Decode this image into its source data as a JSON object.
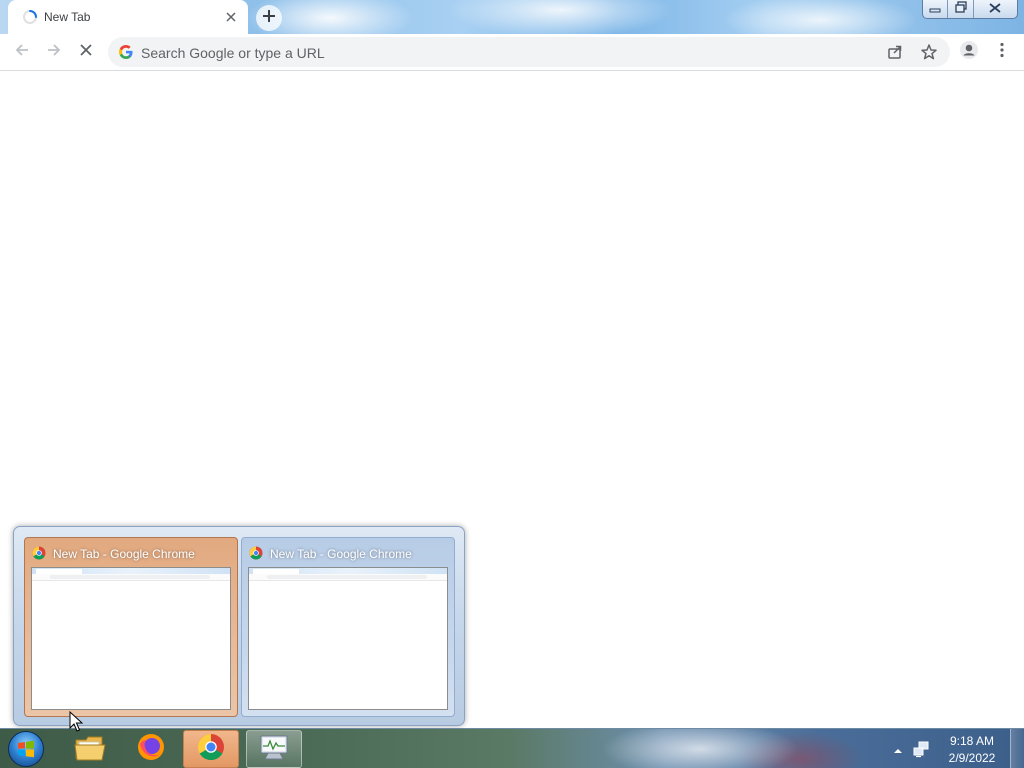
{
  "browser": {
    "tab": {
      "title": "New Tab",
      "loading_icon": "loading-spinner-icon",
      "close_icon": "close-icon"
    },
    "new_tab_icon": "plus-icon",
    "window_controls": {
      "minimize_icon": "minimize-icon",
      "restore_icon": "restore-icon",
      "close_icon": "close-icon"
    },
    "toolbar": {
      "back_icon": "back-arrow-icon",
      "forward_icon": "forward-arrow-icon",
      "stop_icon": "stop-icon",
      "omnibox_placeholder": "Search Google or type a URL",
      "search_engine_icon": "google-g-icon",
      "share_icon": "share-icon",
      "bookmark_icon": "star-icon",
      "profile_icon": "profile-icon",
      "menu_icon": "kebab-menu-icon"
    }
  },
  "taskbar_preview": {
    "thumbnails": [
      {
        "title": "New Tab - Google Chrome",
        "icon": "chrome-icon",
        "state": "hovered"
      },
      {
        "title": "New Tab - Google Chrome",
        "icon": "chrome-icon",
        "state": "normal"
      }
    ]
  },
  "taskbar": {
    "start_icon": "windows-start-icon",
    "apps": [
      {
        "name": "Windows Explorer",
        "icon": "folder-icon",
        "running": false
      },
      {
        "name": "Firefox",
        "icon": "firefox-icon",
        "running": false
      },
      {
        "name": "Google Chrome",
        "icon": "chrome-icon",
        "running": true
      },
      {
        "name": "Task Manager",
        "icon": "task-manager-icon",
        "running": true
      }
    ],
    "tray": {
      "overflow_icon": "tray-up-arrow-icon",
      "network_icon": "network-icon",
      "time": "9:18 AM",
      "date": "2/9/2022"
    }
  },
  "colors": {
    "chrome_accent": "#1a73e8",
    "preview_hover": "#e6a57a",
    "taskbar_active": "#e39863"
  }
}
